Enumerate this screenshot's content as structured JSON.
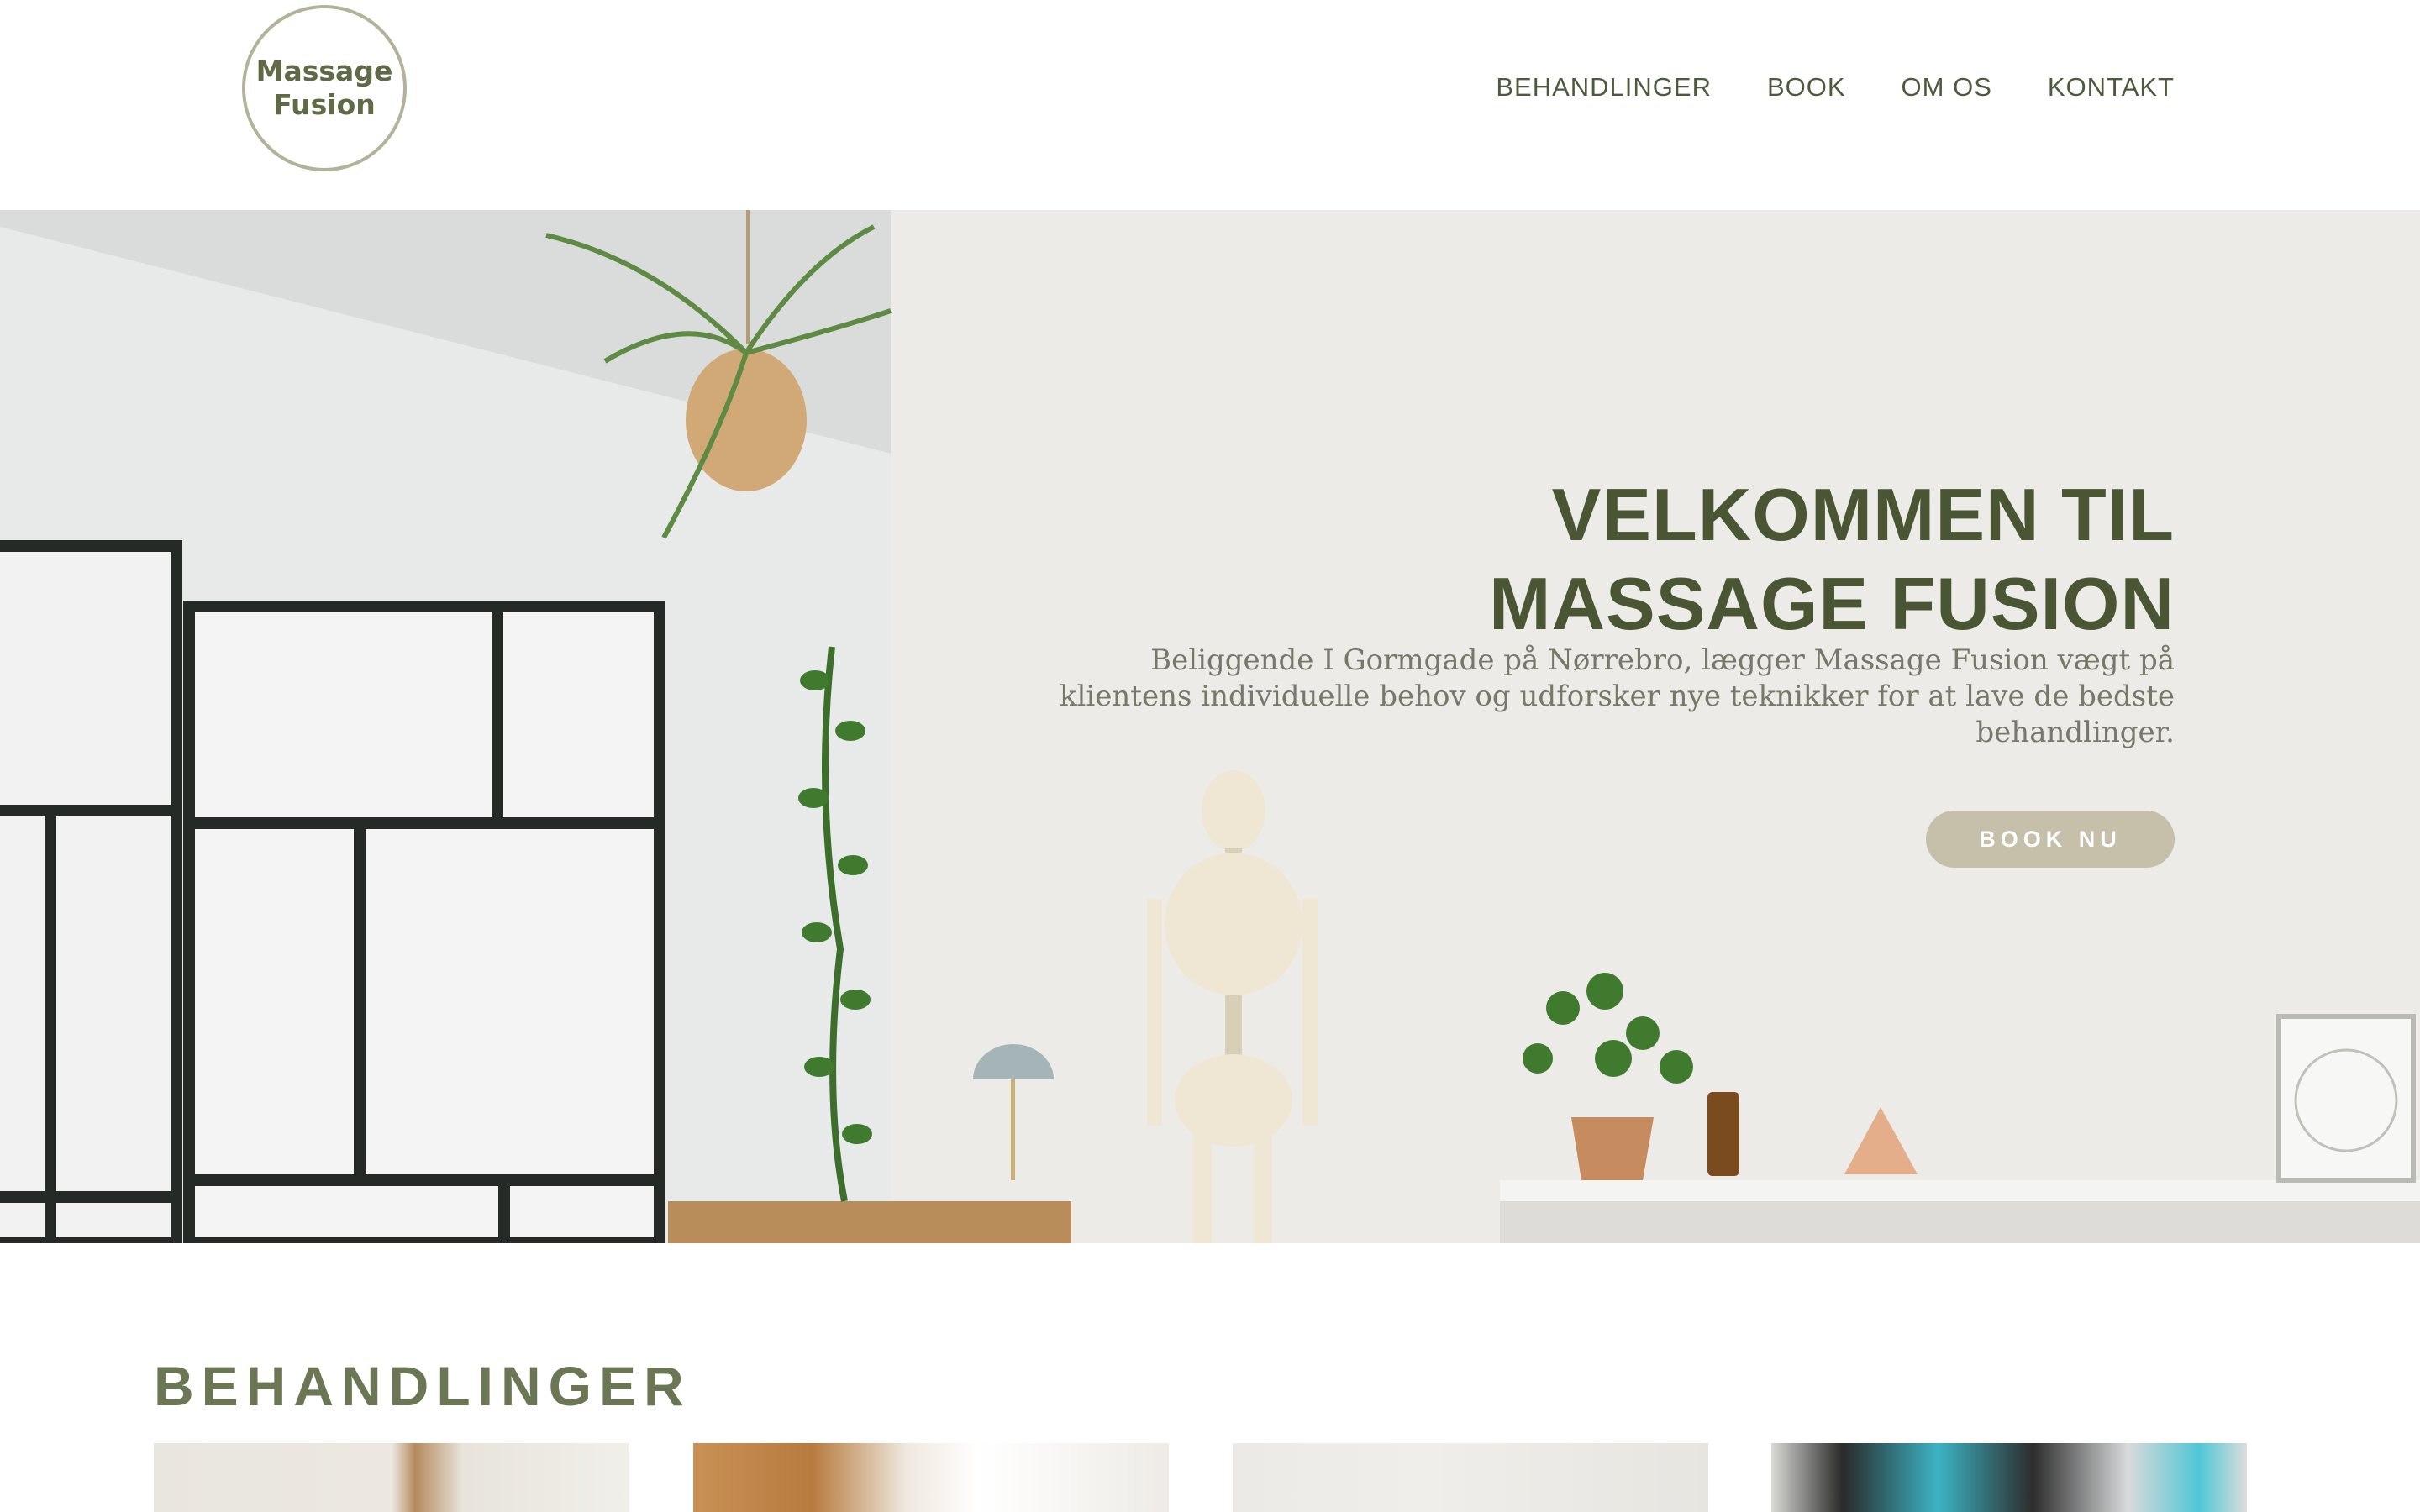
{
  "header": {
    "logo_line1": "Massage",
    "logo_line2": "Fusion",
    "nav": [
      "BEHANDLINGER",
      "BOOK",
      "OM OS",
      "KONTAKT"
    ]
  },
  "hero": {
    "title_line1": "VELKOMMEN TIL",
    "title_line2": "MASSAGE FUSION",
    "subtitle_line1": "Beliggende I Gormgade på Nørrebro, lægger Massage Fusion vægt på",
    "subtitle_line2": "klientens individuelle behov og udforsker nye teknikker for at lave de bedste behandlinger.",
    "cta": "BOOK NU"
  },
  "treatments": {
    "title": "BEHANDLINGER",
    "cards": [
      "card-1",
      "card-2",
      "card-3",
      "card-4"
    ]
  },
  "colors": {
    "brand_green": "#4a5534",
    "nav_green": "#4e5a3d",
    "button_beige": "#c6bfa9"
  }
}
